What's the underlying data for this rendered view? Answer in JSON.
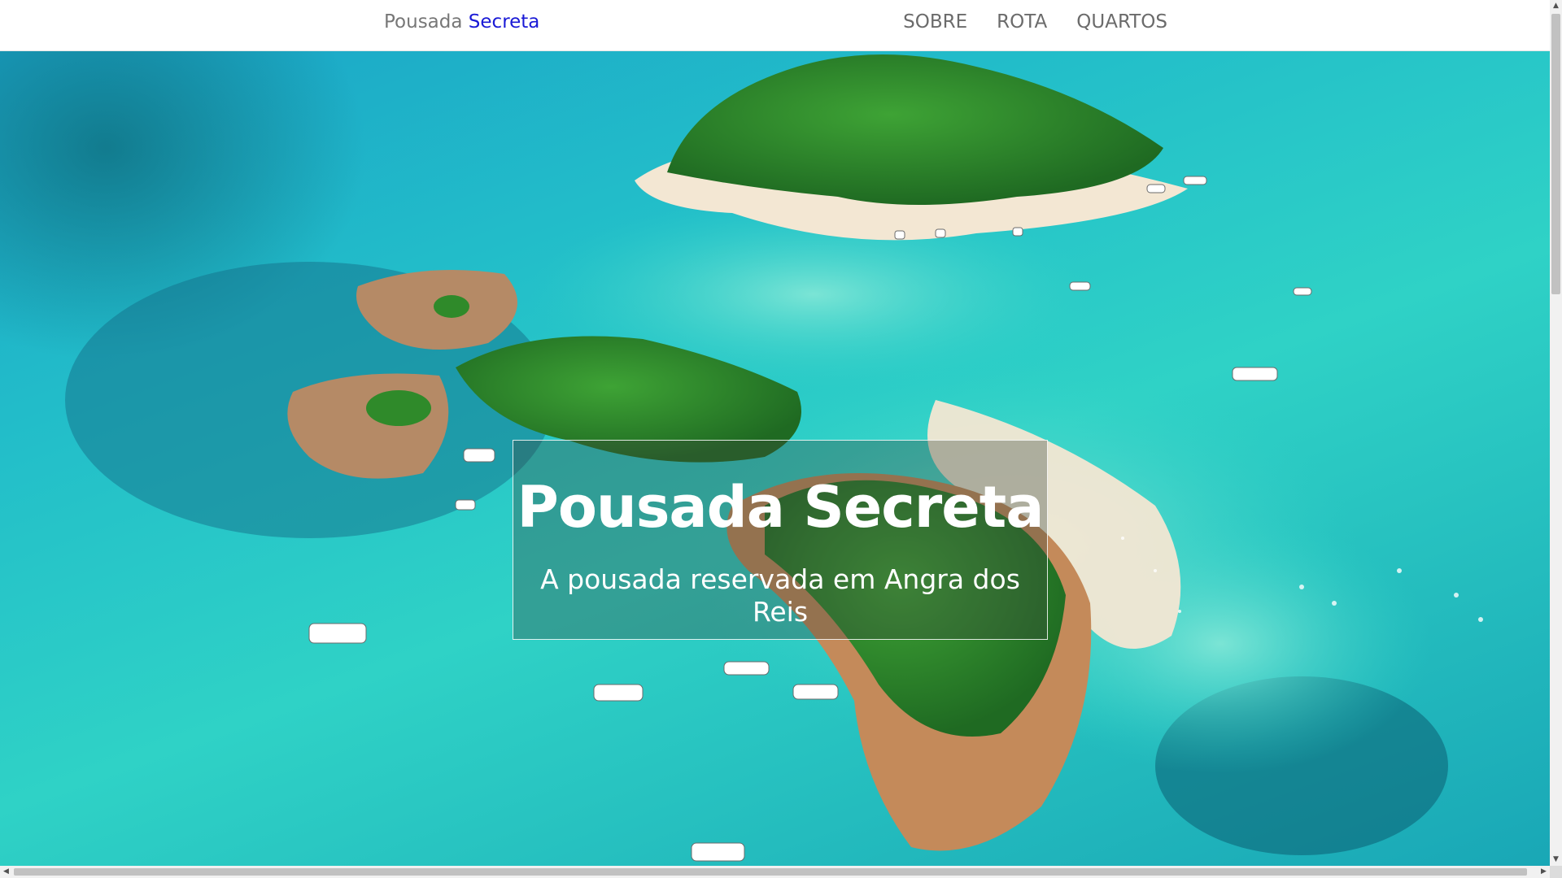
{
  "navbar": {
    "brand_prefix": "Pousada",
    "brand_accent": "Secreta",
    "links": [
      "SOBRE",
      "ROTA",
      "QUARTOS"
    ]
  },
  "hero": {
    "title": "Pousada Secreta",
    "subtitle": "A pousada reservada em Angra dos Reis"
  },
  "scrollbars": {
    "up_arrow": "▲",
    "down_arrow": "▼",
    "left_arrow": "◀",
    "right_arrow": "▶"
  },
  "colors": {
    "brand_accent": "#1a1ad6",
    "nav_text": "#6b6b6b",
    "sea": "#23bfc9",
    "vegetation": "#2f8a2a",
    "sand": "#f3e7d3"
  }
}
